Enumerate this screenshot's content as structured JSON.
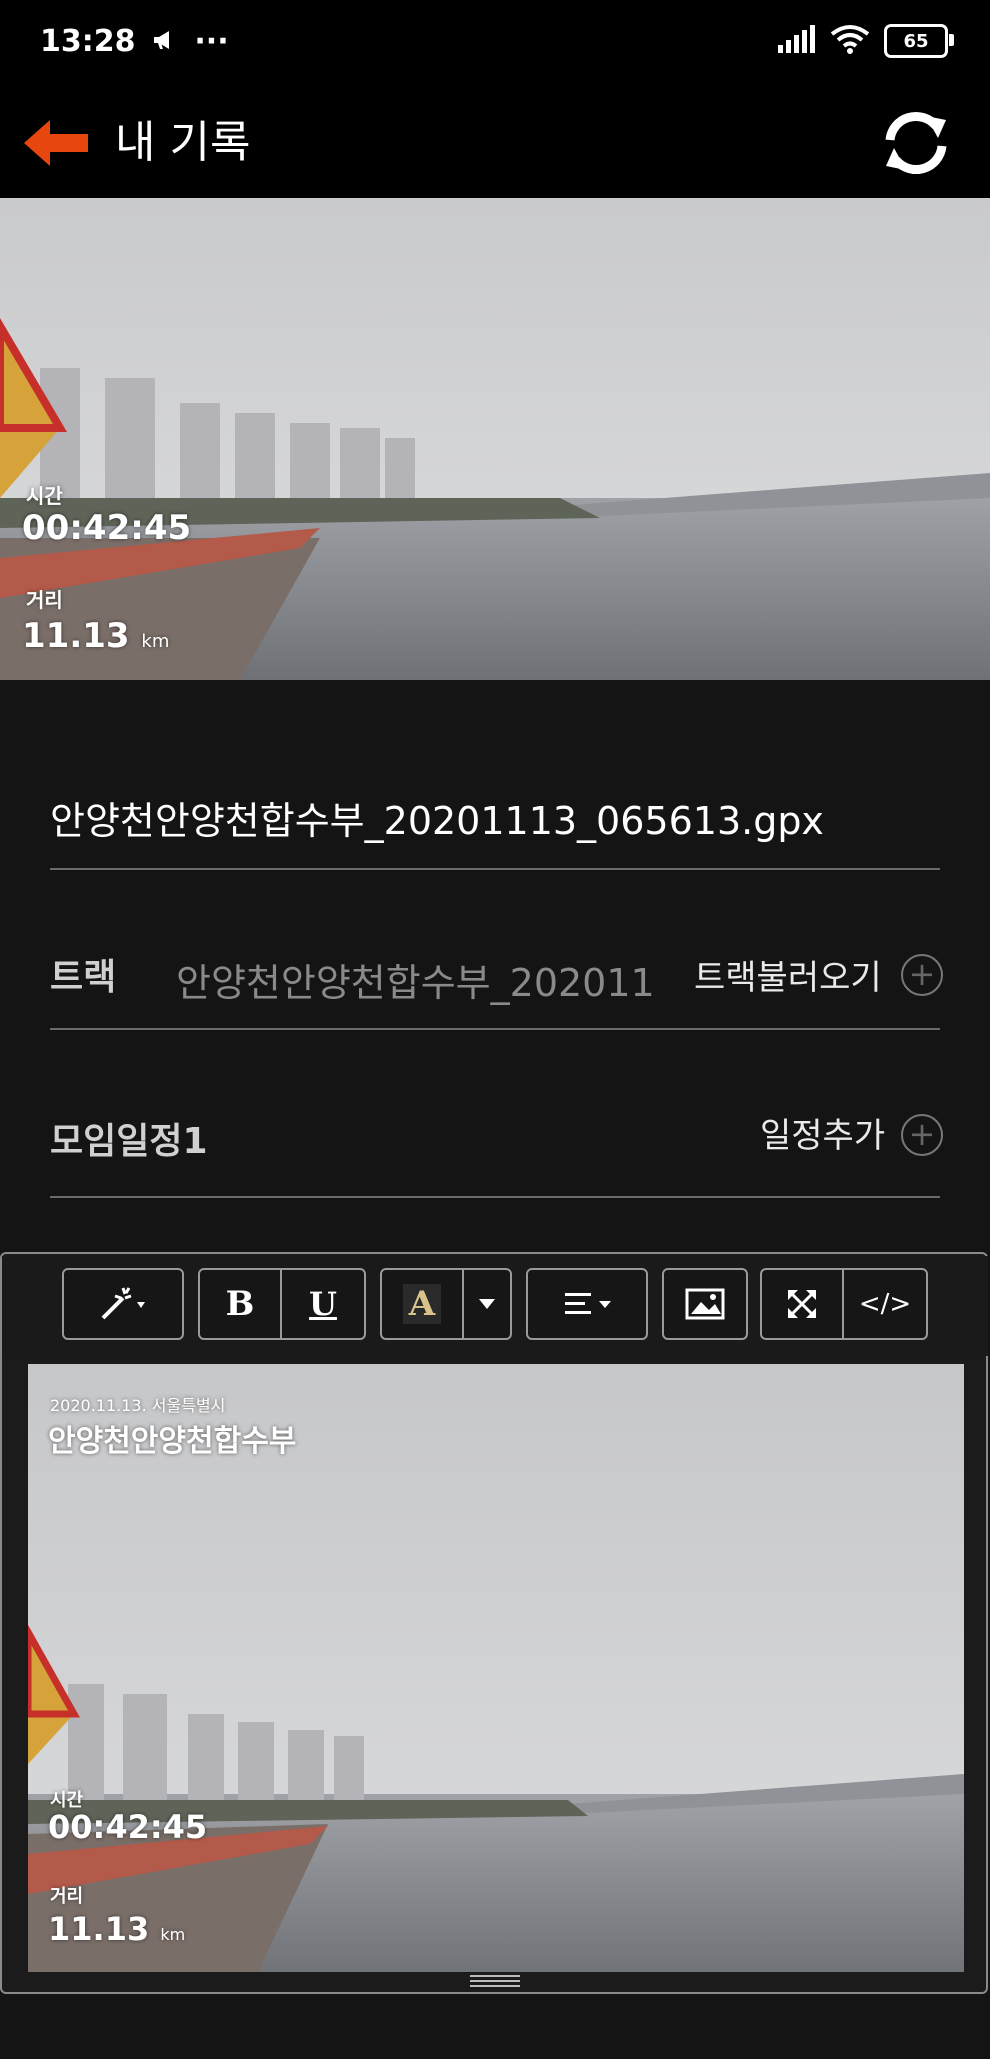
{
  "status_bar": {
    "time": "13:28",
    "extra": "···",
    "battery": "65"
  },
  "header": {
    "title": "내 기록"
  },
  "photo_top": {
    "time_label": "시간",
    "time_value": "00:42:45",
    "distance_label": "거리",
    "distance_value": "11.13",
    "distance_unit": "km"
  },
  "form": {
    "filename": "안양천안양천합수부_20201113_065613.gpx",
    "track": {
      "label": "트랙",
      "value": "안양천안양천합수부_202011",
      "action": "트랙불러오기"
    },
    "schedule": {
      "label": "모임일정1",
      "action": "일정추가"
    }
  },
  "toolbar": {
    "bold": "B",
    "underline": "U",
    "font_color": "A",
    "code": "</>"
  },
  "photo_bottom": {
    "date_place": "2020.11.13. 서울특별시",
    "place_title": "안양천안양천합수부",
    "time_label": "시간",
    "time_value": "00:42:45",
    "distance_label": "거리",
    "distance_value": "11.13",
    "distance_unit": "km"
  },
  "colors": {
    "accent": "#e8460f",
    "background": "#141414"
  },
  "icons": [
    "megaphone-icon",
    "signal-icon",
    "wifi-icon",
    "battery-icon",
    "back-arrow-icon",
    "refresh-icon",
    "magic-wand-icon",
    "align-icon",
    "image-icon",
    "fullscreen-icon",
    "plus-circle-icon",
    "drag-handle-icon"
  ]
}
